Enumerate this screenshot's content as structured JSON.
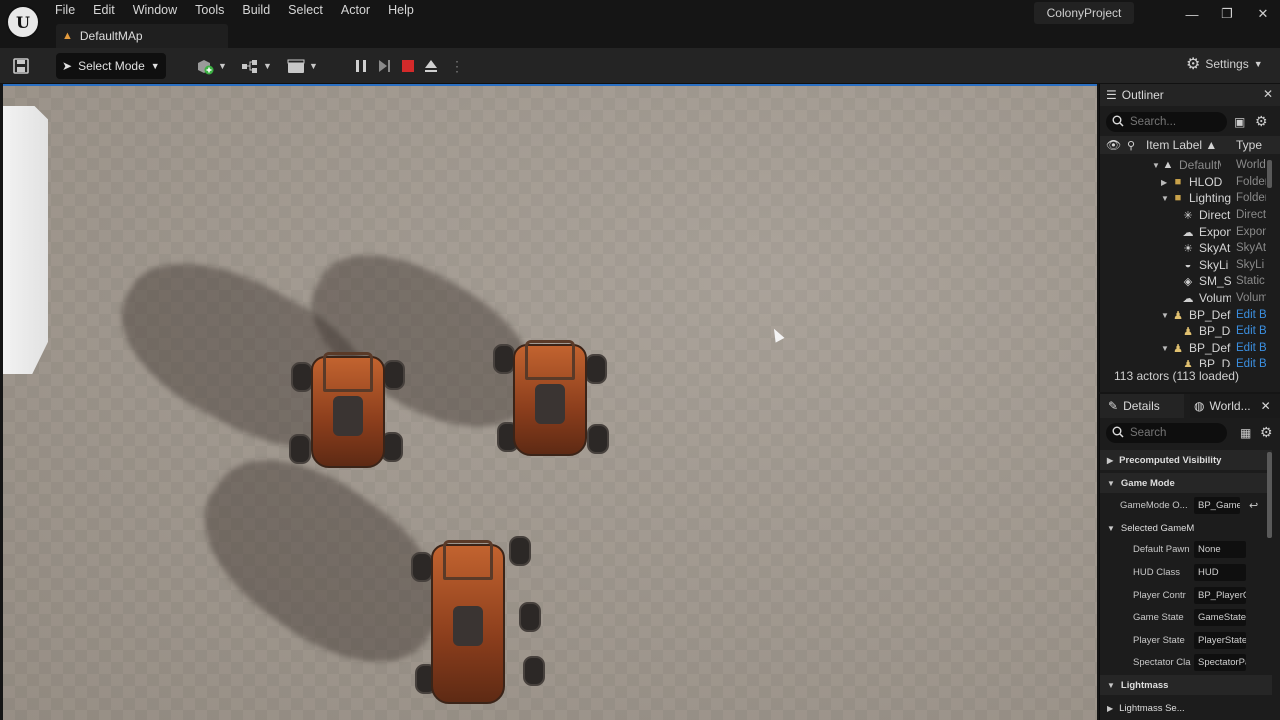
{
  "titlebar": {
    "menu": [
      "File",
      "Edit",
      "Window",
      "Tools",
      "Build",
      "Select",
      "Actor",
      "Help"
    ],
    "level_tab": "DefaultMAp",
    "project_name": "ColonyProject",
    "window_controls": {
      "minimize": "—",
      "maximize": "❐",
      "close": "✕"
    }
  },
  "toolbar": {
    "mode_label": "Select Mode",
    "settings_label": "Settings"
  },
  "outliner": {
    "title": "Outliner",
    "search_placeholder": "Search...",
    "col_label": "Item Label ▲",
    "col_type": "Type",
    "rows": [
      {
        "label": "DefaultMA",
        "type": "World",
        "link": false
      },
      {
        "label": "HLOD",
        "type": "Folder",
        "link": false
      },
      {
        "label": "Lighting",
        "type": "Folder",
        "link": false
      },
      {
        "label": "Direct",
        "type": "Direct",
        "link": false
      },
      {
        "label": "Expon",
        "type": "Expon",
        "link": false
      },
      {
        "label": "SkyAt",
        "type": "SkyAt",
        "link": false
      },
      {
        "label": "SkyLi",
        "type": "SkyLi",
        "link": false
      },
      {
        "label": "SM_Sk",
        "type": "Static",
        "link": false
      },
      {
        "label": "Volum",
        "type": "Volum",
        "link": false
      },
      {
        "label": "BP_Defa",
        "type": "Edit B",
        "link": true
      },
      {
        "label": "BP_De",
        "type": "Edit B",
        "link": true
      },
      {
        "label": "BP_Defa",
        "type": "Edit B",
        "link": true
      },
      {
        "label": "BP_De",
        "type": "Edit B",
        "link": true
      }
    ],
    "actor_count": "113 actors (113 loaded)"
  },
  "details": {
    "tab_details": "Details",
    "tab_world": "World...",
    "search_placeholder": "Search",
    "sections": {
      "precomputed": "Precomputed Visibility",
      "game_mode": "Game Mode",
      "selected_game_mode": "Selected GameM",
      "lightmass": "Lightmass",
      "lightmass_settings": "Lightmass Se..."
    },
    "props": [
      {
        "name": "GameMode O...",
        "value": "BP_GameM"
      },
      {
        "name": "Default Pawn",
        "value": "None"
      },
      {
        "name": "HUD Class",
        "value": "HUD"
      },
      {
        "name": "Player Contr",
        "value": "BP_PlayerC"
      },
      {
        "name": "Game State",
        "value": "GameStateB"
      },
      {
        "name": "Player State",
        "value": "PlayerState"
      },
      {
        "name": "Spectator Cla",
        "value": "SpectatorPa"
      }
    ]
  },
  "colors": {
    "accent": "#2a6fc2",
    "link": "#3b8fe0",
    "stop": "#d42a2a",
    "tab_icon": "#e39a3d"
  }
}
